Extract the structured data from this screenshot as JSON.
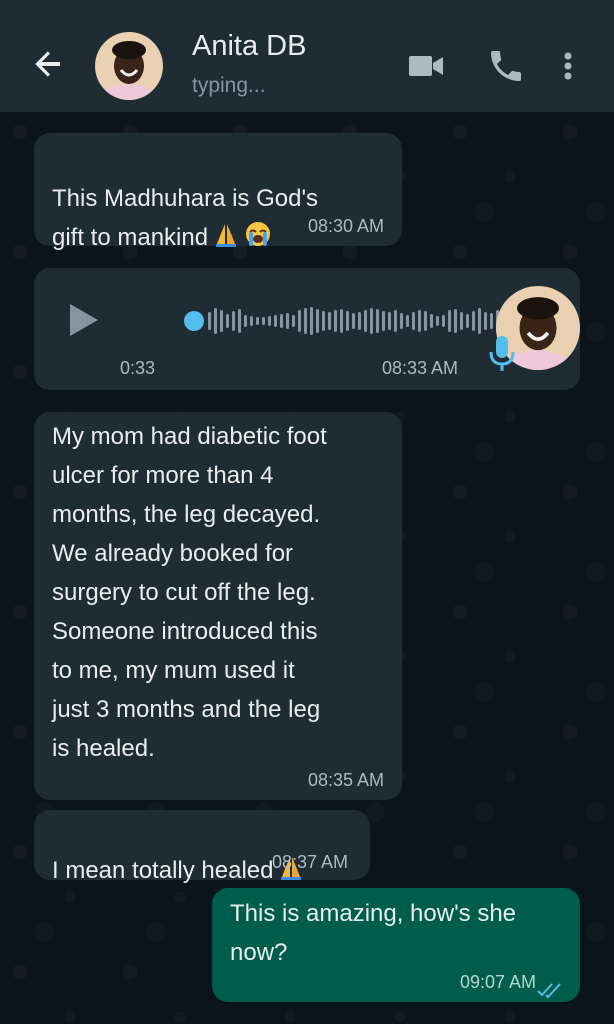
{
  "header": {
    "contact_name": "Anita DB",
    "status": "typing...",
    "icons": [
      "back-arrow-icon",
      "video-call-icon",
      "voice-call-icon",
      "more-options-icon"
    ]
  },
  "messages": [
    {
      "type": "text",
      "direction": "in",
      "text": "This Madhuhara is God's\ngift to mankind",
      "emoji": [
        "folded-hands",
        "crying-face"
      ],
      "time": "08:30 AM"
    },
    {
      "type": "voice",
      "direction": "in",
      "duration": "0:33",
      "time": "08:33 AM"
    },
    {
      "type": "text",
      "direction": "in",
      "text": "My mom had diabetic foot\nulcer for more than 4\nmonths, the leg decayed.\nWe already booked for\nsurgery to cut off the leg.\nSomeone introduced this\nto me, my mum used it\njust 3 months and the leg\nis healed.",
      "time": "08:35 AM"
    },
    {
      "type": "text",
      "direction": "in",
      "text": "I mean totally healed",
      "emoji": [
        "folded-hands"
      ],
      "time": "08:37 AM"
    },
    {
      "type": "text",
      "direction": "out",
      "text": "This is amazing, how's she\nnow?",
      "time": "09:07 AM",
      "receipt": "double-check-read"
    }
  ],
  "colors": {
    "header_bg": "#1f2c34",
    "chat_bg": "#0b141a",
    "incoming_bubble": "#1f2c34",
    "outgoing_bubble": "#005c4b",
    "accent_blue": "#53bdeb",
    "text_primary": "#e9edef",
    "text_secondary": "#8696a0"
  }
}
